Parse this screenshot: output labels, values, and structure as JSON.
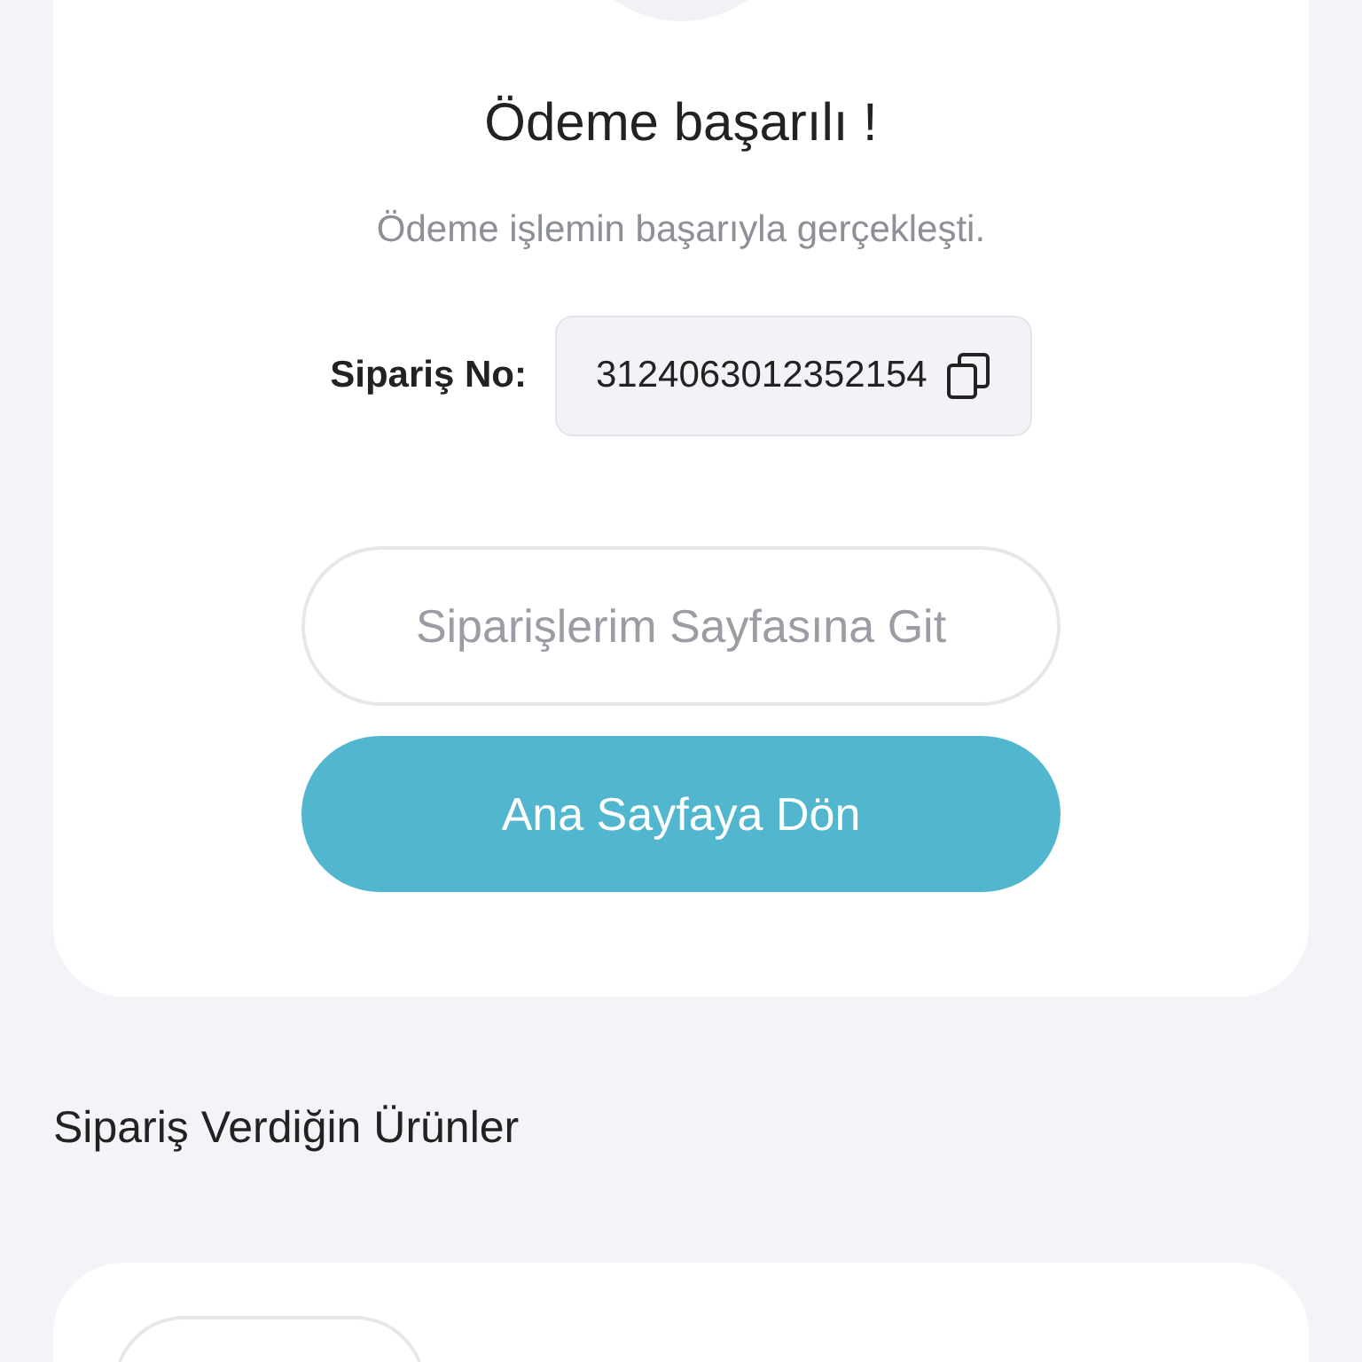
{
  "success_card": {
    "title": "Ödeme başarılı !",
    "message": "Ödeme işlemin başarıyla gerçekleşti.",
    "order_label": "Sipariş No:",
    "order_number": "3124063012352154",
    "buttons": [
      {
        "label": "Siparişlerim Sayfasına Git",
        "kind": "outline"
      },
      {
        "label": "Ana Sayfaya Dön",
        "kind": "primary"
      }
    ]
  },
  "products_section": {
    "title": "Sipariş Verdiğin Ürünler"
  }
}
